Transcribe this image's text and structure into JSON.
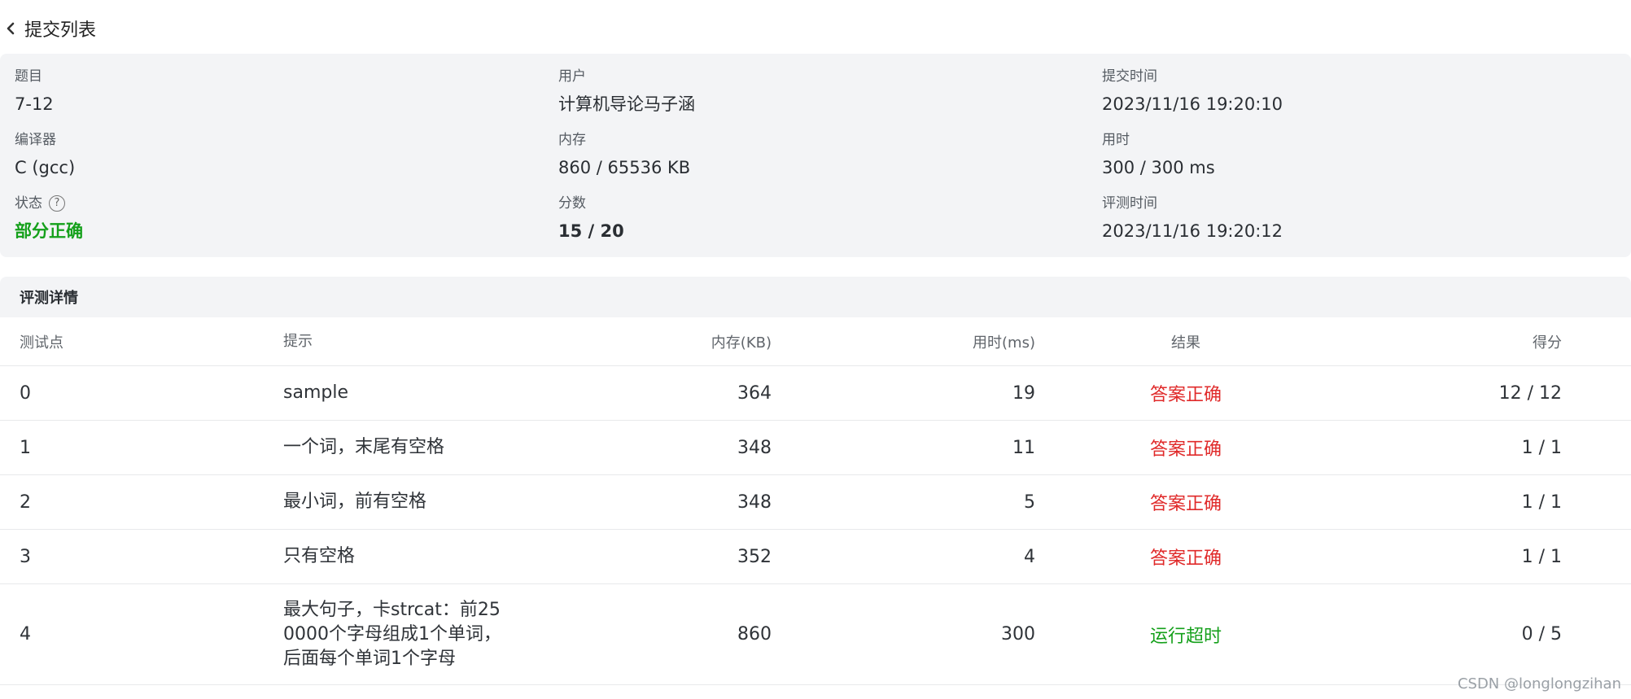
{
  "nav": {
    "back_label": "提交列表"
  },
  "summary": {
    "problem": {
      "label": "题目",
      "value": "7-12"
    },
    "user": {
      "label": "用户",
      "value": "计算机导论马子涵"
    },
    "submit_time": {
      "label": "提交时间",
      "value": "2023/11/16 19:20:10"
    },
    "compiler": {
      "label": "编译器",
      "value": "C (gcc)"
    },
    "memory": {
      "label": "内存",
      "value": "860 / 65536 KB"
    },
    "duration": {
      "label": "用时",
      "value": "300 / 300 ms"
    },
    "status": {
      "label": "状态",
      "value": "部分正确",
      "help_icon": "?"
    },
    "score": {
      "label": "分数",
      "value": "15 / 20"
    },
    "judge_time": {
      "label": "评测时间",
      "value": "2023/11/16 19:20:12"
    }
  },
  "details": {
    "title": "评测详情",
    "columns": {
      "case": "测试点",
      "hint": "提示",
      "memory": "内存(KB)",
      "time": "用时(ms)",
      "result": "结果",
      "score": "得分"
    },
    "rows": [
      {
        "case": "0",
        "hint": "sample",
        "memory": "364",
        "time": "19",
        "result": "答案正确",
        "score": "12 / 12"
      },
      {
        "case": "1",
        "hint": "一个词，末尾有空格",
        "memory": "348",
        "time": "11",
        "result": "答案正确",
        "score": "1 / 1"
      },
      {
        "case": "2",
        "hint": "最小词，前有空格",
        "memory": "348",
        "time": "5",
        "result": "答案正确",
        "score": "1 / 1"
      },
      {
        "case": "3",
        "hint": "只有空格",
        "memory": "352",
        "time": "4",
        "result": "答案正确",
        "score": "1 / 1"
      },
      {
        "case": "4",
        "hint_lines": [
          "最大句子，卡strcat：前25",
          "0000个字母组成1个单词，",
          "后面每个单词1个字母"
        ],
        "memory": "860",
        "time": "300",
        "result": "运行超时",
        "score": "0 / 5"
      }
    ]
  },
  "watermark": "CSDN @longlongzihan",
  "colors": {
    "accepted": "#e02a2a",
    "partial_correct": "#15a01b",
    "time_limit_exceeded": "#15a01b",
    "panel_bg": "#f3f4f6"
  },
  "icons": {
    "back": "chevron-left-icon",
    "help": "question-circle-icon"
  }
}
